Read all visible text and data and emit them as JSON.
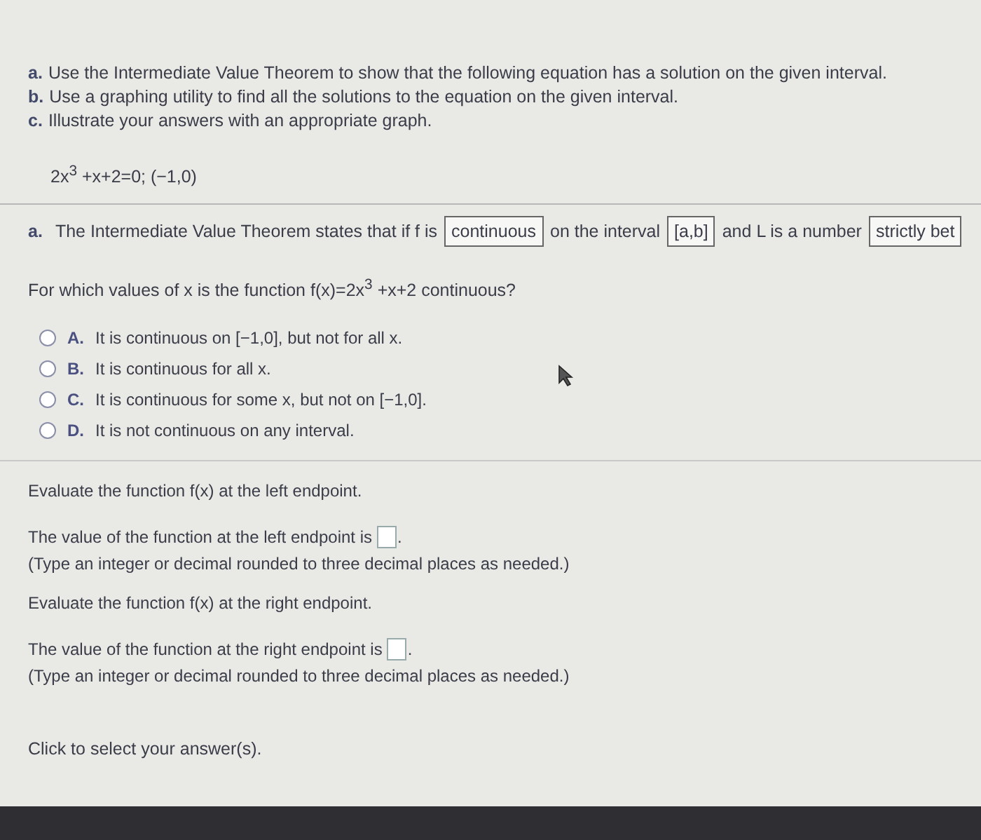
{
  "instructions": [
    {
      "label": "a.",
      "text": "Use the Intermediate Value Theorem to show that the following equation has a solution on the given interval."
    },
    {
      "label": "b.",
      "text": "Use a graphing utility to find all the solutions to the equation on the given interval."
    },
    {
      "label": "c.",
      "text": "Illustrate your answers with an appropriate graph."
    }
  ],
  "equation": "2x$^{3}$ +x+2=0; (−1,0)",
  "theorem_statement": [
    {
      "kind": "label",
      "text": "a."
    },
    {
      "kind": "text",
      "text": "The Intermediate Value Theorem states that if f is"
    },
    {
      "kind": "box",
      "text": "continuous"
    },
    {
      "kind": "text",
      "text": "on the interval"
    },
    {
      "kind": "box",
      "text": "[a,b]"
    },
    {
      "kind": "text",
      "text": "and L is a number"
    },
    {
      "kind": "box",
      "text": "strictly bet"
    }
  ],
  "question": "For which values of x is the function f(x)=2x$^{3}$ +x+2 continuous?",
  "options": [
    {
      "letter": "A.",
      "text": "It is continuous on [−1,0], but not for all x.",
      "selected": false
    },
    {
      "letter": "B.",
      "text": "It is continuous for all x.",
      "selected": false
    },
    {
      "letter": "C.",
      "text": "It is continuous for some x, but not on [−1,0].",
      "selected": false
    },
    {
      "letter": "D.",
      "text": "It is not continuous on any interval.",
      "selected": false
    }
  ],
  "evaluations": [
    {
      "prompt": "Evaluate the function f(x) at the left endpoint.",
      "answer_label": "The value of the function at the left endpoint is",
      "after_field": ".",
      "hint": "(Type an integer or decimal rounded to three decimal places as needed.)"
    },
    {
      "prompt": "Evaluate the function f(x) at the right endpoint.",
      "answer_label": "The value of the function at the right endpoint is",
      "after_field": ".",
      "hint": "(Type an integer or decimal rounded to three decimal places as needed.)"
    }
  ],
  "footer": "Click to select your answer(s)."
}
